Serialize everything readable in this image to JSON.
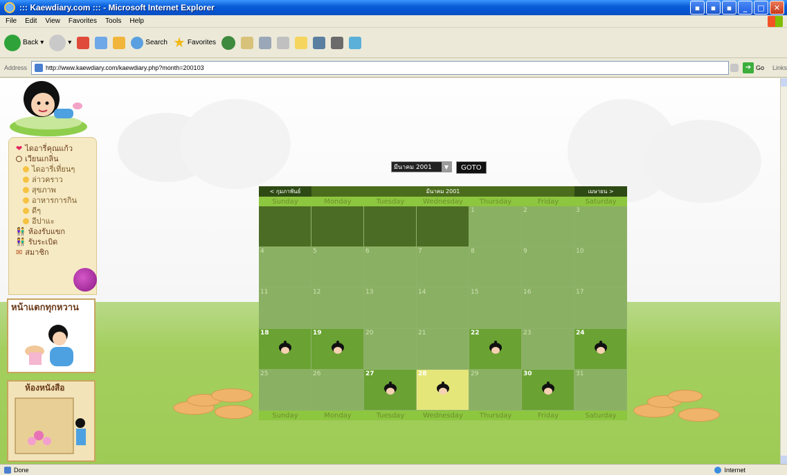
{
  "window": {
    "title": "::: Kaewdiary.com ::: - Microsoft Internet Explorer"
  },
  "menu": [
    "File",
    "Edit",
    "View",
    "Favorites",
    "Tools",
    "Help"
  ],
  "toolbar": {
    "back": "Back",
    "search": "Search",
    "favorites": "Favorites"
  },
  "address": {
    "label": "Address",
    "url": "http://www.kaewdiary.com/kaewdiary.php?month=200103",
    "go": "Go",
    "links": "Links"
  },
  "sidebar": {
    "items": [
      {
        "label": "ไดอารี่คุณแก้ว",
        "icon": "heart-icon"
      },
      {
        "label": "เวียนเกลิ่น",
        "icon": "circle-icon"
      },
      {
        "label": "ไดอารี่เที่ยนๆ",
        "icon": "dot-icon",
        "sub": true
      },
      {
        "label": "ล่าวคราว",
        "icon": "dot-icon",
        "sub": true
      },
      {
        "label": "สุขภาพ",
        "icon": "dot-icon",
        "sub": true
      },
      {
        "label": "อาหารการกิน",
        "icon": "dot-icon",
        "sub": true
      },
      {
        "label": "ดีๆ",
        "icon": "dot-icon",
        "sub": true
      },
      {
        "label": "อีปาแะ",
        "icon": "dot-icon",
        "sub": true
      },
      {
        "label": "ห้องรับแขก",
        "icon": "people-icon"
      },
      {
        "label": "รับระเบิด",
        "icon": "people-icon"
      },
      {
        "label": "สมาชิก",
        "icon": "mail-icon"
      }
    ],
    "panel_sweet": "หน้าแตกทุกหวาน",
    "panel_book": "ห้องหนังสือ"
  },
  "selector": {
    "month_value": "มีนาคม 2001",
    "goto": "GOTO"
  },
  "calendar": {
    "prev": "< กุมภาพันธ์",
    "month": "มีนาคม 2001",
    "next": "เมษายน >",
    "days": [
      "Sunday",
      "Monday",
      "Tuesday",
      "Wednesday",
      "Thursday",
      "Friday",
      "Saturday"
    ],
    "cells": [
      {
        "n": "",
        "t": "empty"
      },
      {
        "n": "",
        "t": "empty"
      },
      {
        "n": "",
        "t": "empty"
      },
      {
        "n": "",
        "t": "empty"
      },
      {
        "n": "1",
        "t": ""
      },
      {
        "n": "2",
        "t": ""
      },
      {
        "n": "3",
        "t": ""
      },
      {
        "n": "4",
        "t": ""
      },
      {
        "n": "5",
        "t": ""
      },
      {
        "n": "6",
        "t": ""
      },
      {
        "n": "7",
        "t": ""
      },
      {
        "n": "8",
        "t": ""
      },
      {
        "n": "9",
        "t": ""
      },
      {
        "n": "10",
        "t": ""
      },
      {
        "n": "11",
        "t": ""
      },
      {
        "n": "12",
        "t": ""
      },
      {
        "n": "13",
        "t": ""
      },
      {
        "n": "14",
        "t": ""
      },
      {
        "n": "15",
        "t": ""
      },
      {
        "n": "16",
        "t": ""
      },
      {
        "n": "17",
        "t": ""
      },
      {
        "n": "18",
        "t": "event"
      },
      {
        "n": "19",
        "t": "event"
      },
      {
        "n": "20",
        "t": ""
      },
      {
        "n": "21",
        "t": ""
      },
      {
        "n": "22",
        "t": "event"
      },
      {
        "n": "23",
        "t": ""
      },
      {
        "n": "24",
        "t": "event"
      },
      {
        "n": "25",
        "t": ""
      },
      {
        "n": "26",
        "t": ""
      },
      {
        "n": "27",
        "t": "event"
      },
      {
        "n": "28",
        "t": "today"
      },
      {
        "n": "29",
        "t": ""
      },
      {
        "n": "30",
        "t": "event"
      },
      {
        "n": "31",
        "t": ""
      }
    ]
  },
  "status": {
    "left": "Done",
    "zone": "Internet"
  }
}
